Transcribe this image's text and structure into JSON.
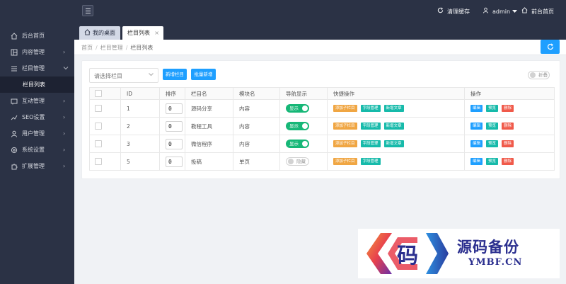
{
  "sidebar": {
    "items": [
      {
        "label": "后台首页",
        "icon": "home-icon"
      },
      {
        "label": "内容管理",
        "icon": "content-icon",
        "chevron": "›"
      },
      {
        "label": "栏目管理",
        "icon": "menu-lines-icon",
        "chevron": "⌄"
      },
      {
        "label": "栏目列表",
        "icon": ""
      },
      {
        "label": "互动管理",
        "icon": "interact-icon",
        "chevron": "›"
      },
      {
        "label": "SEO设置",
        "icon": "seo-icon",
        "chevron": "›"
      },
      {
        "label": "用户管理",
        "icon": "user-icon",
        "chevron": "›"
      },
      {
        "label": "系统设置",
        "icon": "gear-icon",
        "chevron": "›"
      },
      {
        "label": "扩展管理",
        "icon": "puzzle-icon",
        "chevron": "›"
      }
    ]
  },
  "header": {
    "clear_cache": "清理缓存",
    "user": "admin",
    "front_home": "前台首页"
  },
  "tabs": {
    "home": "我的桌面",
    "current": "栏目列表",
    "close_glyph": "×"
  },
  "breadcrumb": {
    "items": [
      "首页",
      "栏目管理",
      "栏目列表"
    ],
    "sep": "/"
  },
  "toolbar": {
    "select_placeholder": "请选择栏目",
    "add_label": "新增栏目",
    "batch_label": "批量新增",
    "fold_label": "折叠"
  },
  "table": {
    "headers": [
      "",
      "ID",
      "排序",
      "栏目名",
      "模块名",
      "导航显示",
      "快捷操作",
      "操作"
    ],
    "rows": [
      {
        "id": "1",
        "sort": "0",
        "name": "源码分享",
        "module": "内容",
        "nav": "显示",
        "nav_on": true,
        "quick": [
          "添加子栏目",
          "字段管理",
          "新增文章"
        ],
        "ops": [
          "编辑",
          "预览",
          "删除"
        ]
      },
      {
        "id": "2",
        "sort": "0",
        "name": "教程工具",
        "module": "内容",
        "nav": "显示",
        "nav_on": true,
        "quick": [
          "添加子栏目",
          "字段管理",
          "新增文章"
        ],
        "ops": [
          "编辑",
          "预览",
          "删除"
        ]
      },
      {
        "id": "3",
        "sort": "0",
        "name": "微信程序",
        "module": "内容",
        "nav": "显示",
        "nav_on": true,
        "quick": [
          "添加子栏目",
          "字段管理",
          "新增文章"
        ],
        "ops": [
          "编辑",
          "预览",
          "删除"
        ]
      },
      {
        "id": "5",
        "sort": "0",
        "name": "投稿",
        "module": "单页",
        "nav": "隐藏",
        "nav_on": false,
        "quick": [
          "添加子栏目",
          "字段管理"
        ],
        "ops": [
          "编辑",
          "预览",
          "删除"
        ]
      }
    ]
  },
  "watermark": {
    "glyph": "码",
    "cn": "源码备份",
    "en": "YMBF.CN"
  },
  "colors": {
    "sidebar_bg": "#2b3245",
    "accent_blue": "#1e9fff",
    "toggle_green": "#16b777",
    "orange": "#f0a643",
    "teal": "#16baaa",
    "red": "#f05a4a"
  }
}
